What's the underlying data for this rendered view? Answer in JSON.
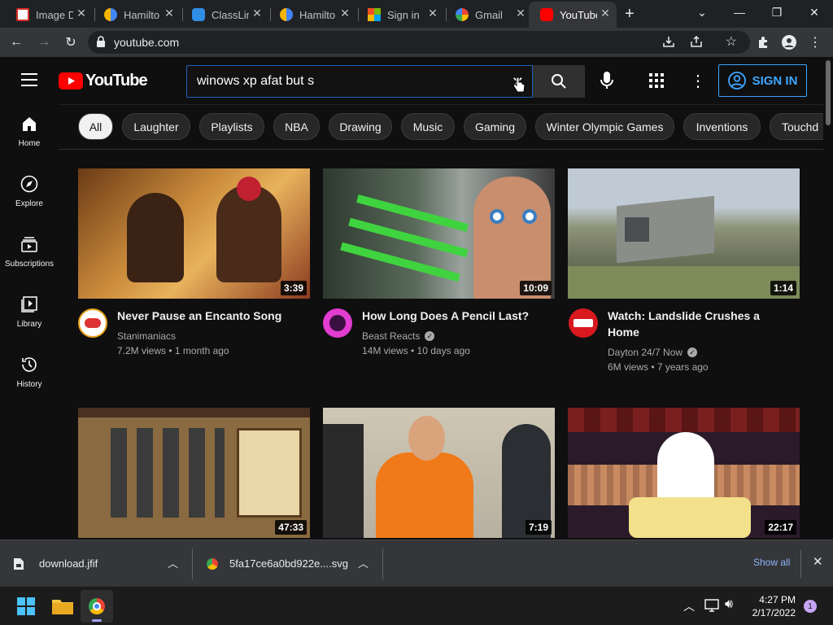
{
  "tabs": [
    {
      "title": "Image D",
      "icon": "image-icon"
    },
    {
      "title": "Hamilto",
      "icon": "hamilton-icon"
    },
    {
      "title": "ClassLin",
      "icon": "classlink-icon"
    },
    {
      "title": "Hamilto",
      "icon": "hamilton-icon"
    },
    {
      "title": "Sign in",
      "icon": "microsoft-icon"
    },
    {
      "title": "Gmail",
      "icon": "google-icon"
    },
    {
      "title": "YouTube",
      "icon": "youtube-icon"
    }
  ],
  "address": {
    "url": "youtube.com"
  },
  "youtube": {
    "logo_text": "YouTube",
    "search_value": "winows xp afat but s",
    "signin_label": "SIGN IN"
  },
  "chips": [
    "All",
    "Laughter",
    "Playlists",
    "NBA",
    "Drawing",
    "Music",
    "Gaming",
    "Winter Olympic Games",
    "Inventions",
    "Touchd"
  ],
  "sidebar": [
    {
      "label": "Home",
      "icon": "home-icon"
    },
    {
      "label": "Explore",
      "icon": "compass-icon"
    },
    {
      "label": "Subscriptions",
      "icon": "subscriptions-icon"
    },
    {
      "label": "Library",
      "icon": "library-icon"
    },
    {
      "label": "History",
      "icon": "history-icon"
    }
  ],
  "videos": [
    {
      "title": "Never Pause an Encanto Song",
      "channel": "Stanimaniacs",
      "verified": false,
      "meta": "7.2M views • 1 month ago",
      "duration": "3:39"
    },
    {
      "title": "How Long Does A Pencil Last?",
      "channel": "Beast Reacts",
      "verified": true,
      "meta": "14M views • 10 days ago",
      "duration": "10:09"
    },
    {
      "title_line1": "Watch: Landslide Crushes a",
      "title_line2": "Home",
      "channel": "Dayton 24/7 Now",
      "verified": true,
      "meta": "6M views • 7 years ago",
      "duration": "1:14"
    },
    {
      "duration": "47:33"
    },
    {
      "duration": "7:19"
    },
    {
      "duration": "22:17"
    }
  ],
  "downloads": [
    {
      "name": "download.jfif"
    },
    {
      "name": "5fa17ce6a0bd922e....svg"
    }
  ],
  "downloads_show_all": "Show all",
  "taskbar": {
    "time": "4:27 PM",
    "date": "2/17/2022",
    "notification_count": "1"
  },
  "colors": {
    "accent_blue": "#3ea6ff",
    "yt_red": "#ff0000",
    "chrome_dark": "#202124"
  }
}
